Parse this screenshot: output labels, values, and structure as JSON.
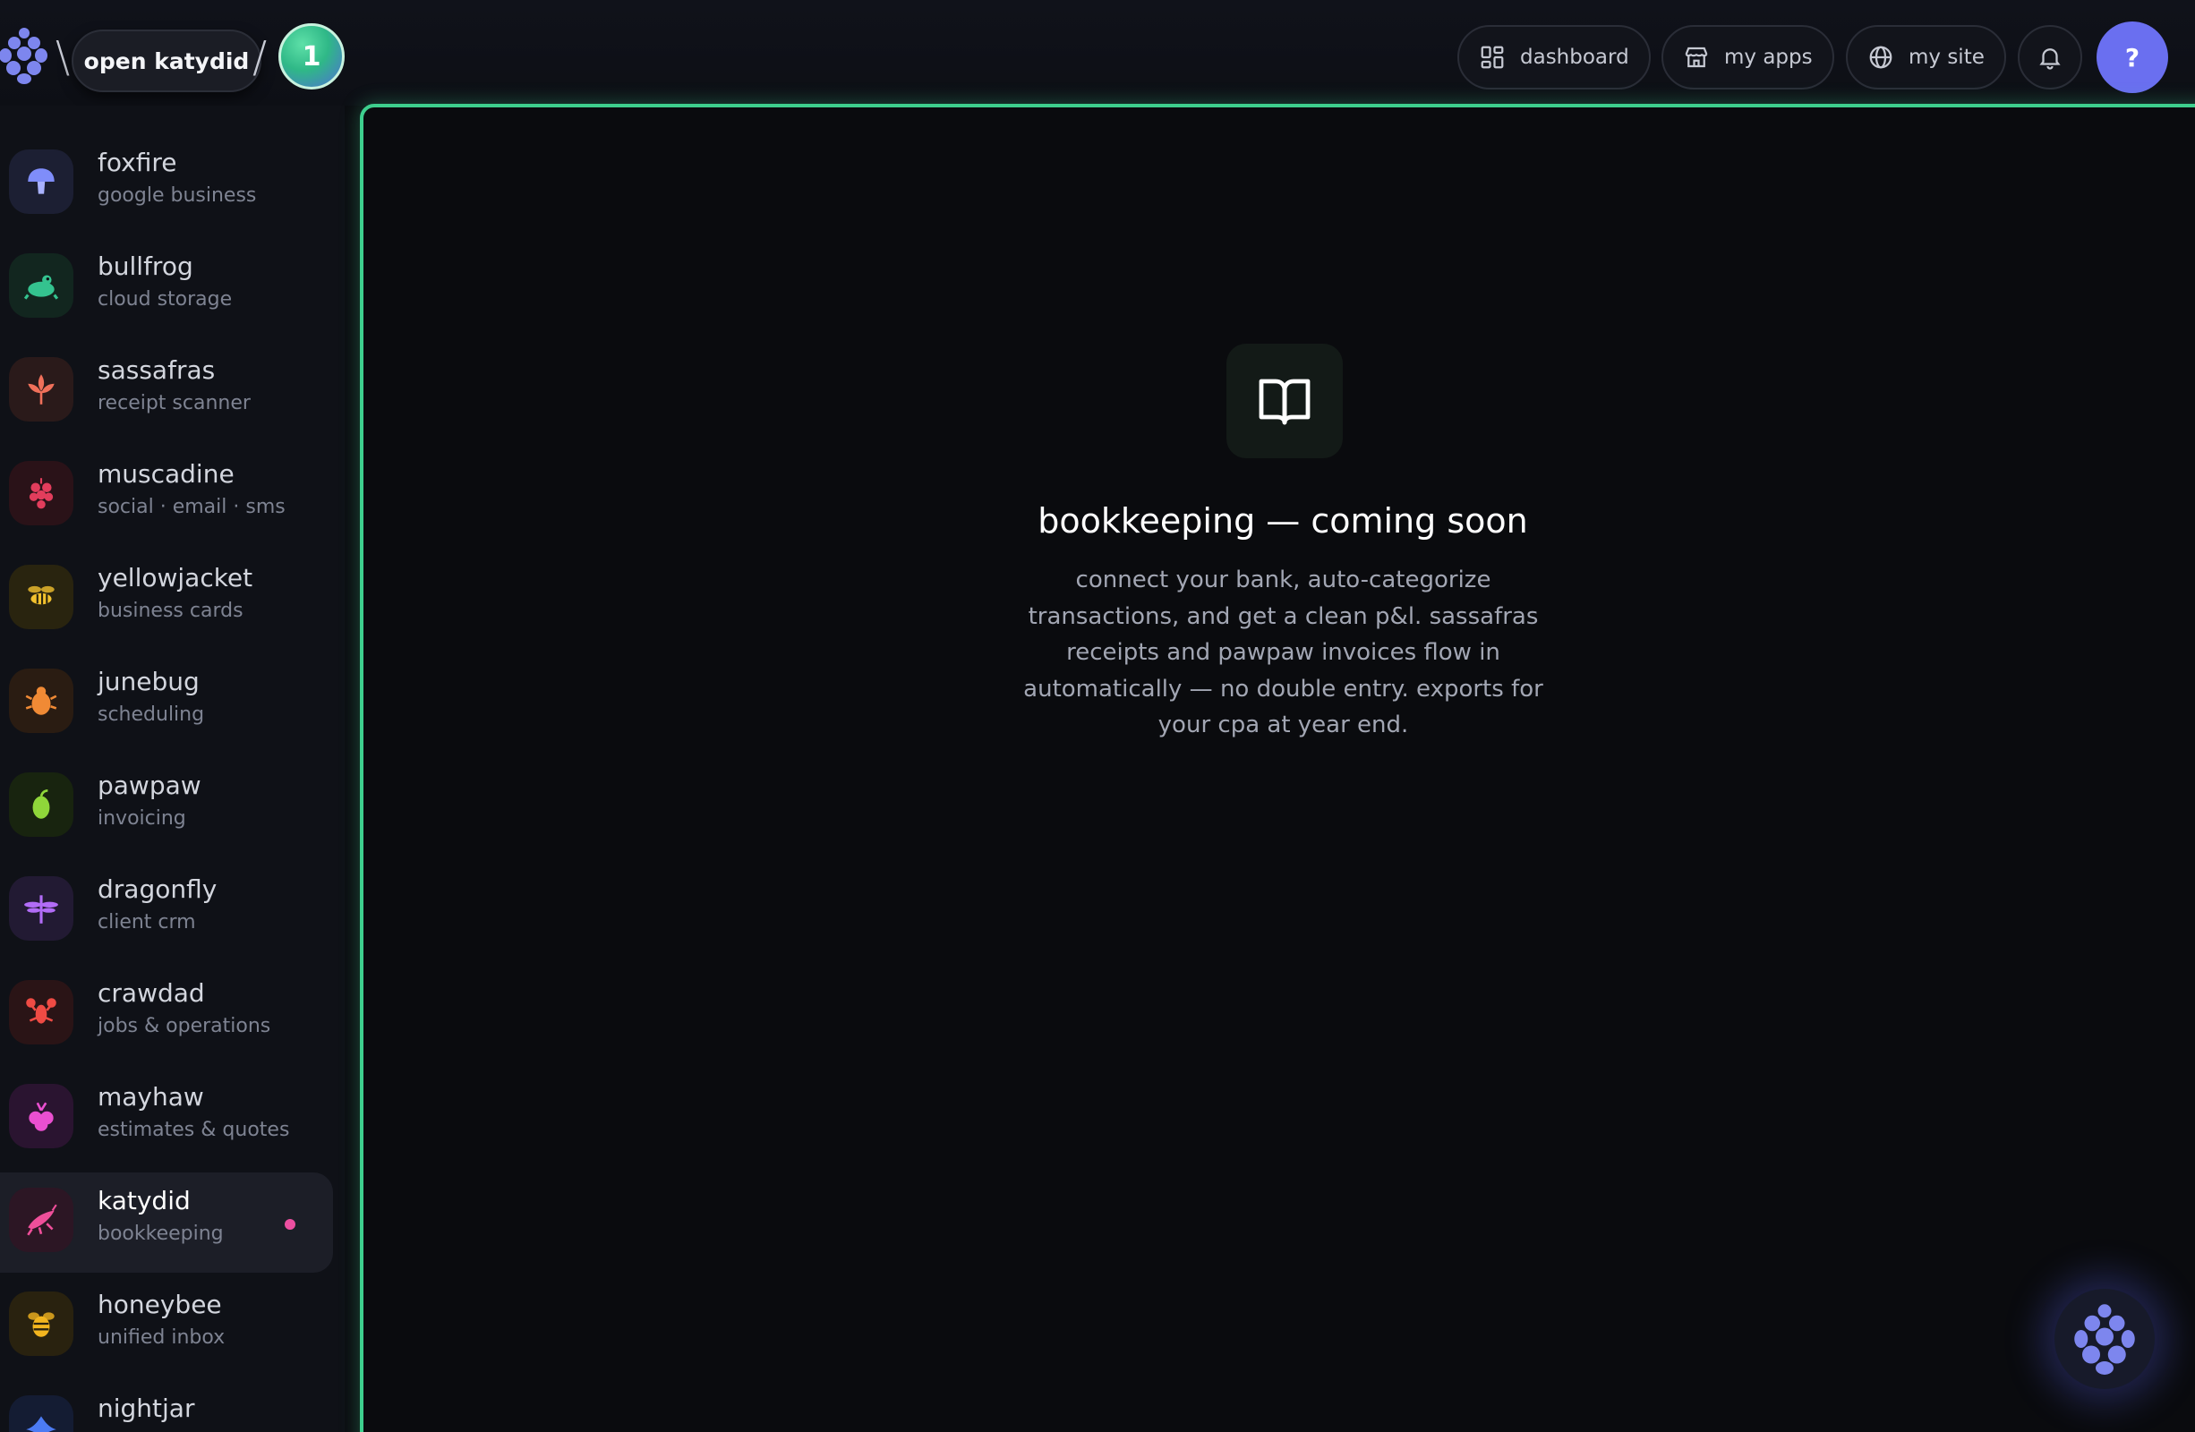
{
  "header": {
    "open_button_label": "open katydid",
    "notification_count": "1",
    "nav": [
      {
        "label": "dashboard",
        "icon": "grid-icon"
      },
      {
        "label": "my apps",
        "icon": "store-icon"
      },
      {
        "label": "my site",
        "icon": "globe-icon"
      }
    ],
    "help_label": "?"
  },
  "sidebar": {
    "items": [
      {
        "name": "foxfire",
        "subtitle": "google business",
        "icon": "mushroom-icon",
        "color": "#7f8dfa"
      },
      {
        "name": "bullfrog",
        "subtitle": "cloud storage",
        "icon": "frog-icon",
        "color": "#34c38f"
      },
      {
        "name": "sassafras",
        "subtitle": "receipt scanner",
        "icon": "leaf-icon",
        "color": "#f0705a"
      },
      {
        "name": "muscadine",
        "subtitle": "social · email · sms",
        "icon": "grapes-icon",
        "color": "#e23d5c"
      },
      {
        "name": "yellowjacket",
        "subtitle": "business cards",
        "icon": "wasp-icon",
        "color": "#f2c12e"
      },
      {
        "name": "junebug",
        "subtitle": "scheduling",
        "icon": "beetle-icon",
        "color": "#f08a35"
      },
      {
        "name": "pawpaw",
        "subtitle": "invoicing",
        "icon": "fruit-icon",
        "color": "#8fd63a"
      },
      {
        "name": "dragonfly",
        "subtitle": "client crm",
        "icon": "dragonfly-icon",
        "color": "#b26cf7"
      },
      {
        "name": "crawdad",
        "subtitle": "jobs & operations",
        "icon": "crawfish-icon",
        "color": "#ef4b44"
      },
      {
        "name": "mayhaw",
        "subtitle": "estimates & quotes",
        "icon": "berry-icon",
        "color": "#ea4fd0"
      },
      {
        "name": "katydid",
        "subtitle": "bookkeeping",
        "icon": "katydid-icon",
        "color": "#ef4f9a",
        "active": true
      },
      {
        "name": "honeybee",
        "subtitle": "unified inbox",
        "icon": "bee-icon",
        "color": "#f2b51f"
      },
      {
        "name": "nightjar",
        "subtitle": "",
        "icon": "bird-icon",
        "color": "#4c7bf3"
      }
    ]
  },
  "main": {
    "icon": "book-icon",
    "title": "bookkeeping — coming soon",
    "description": "connect your bank, auto-categorize transactions, and get a clean p&l. sassafras receipts and pawpaw invoices flow in automatically — no double entry. exports for your cpa at year end."
  },
  "colors": {
    "accent_green": "#3ecf8e",
    "brand_purple": "#6a6ff0",
    "background": "#0b0c10"
  }
}
